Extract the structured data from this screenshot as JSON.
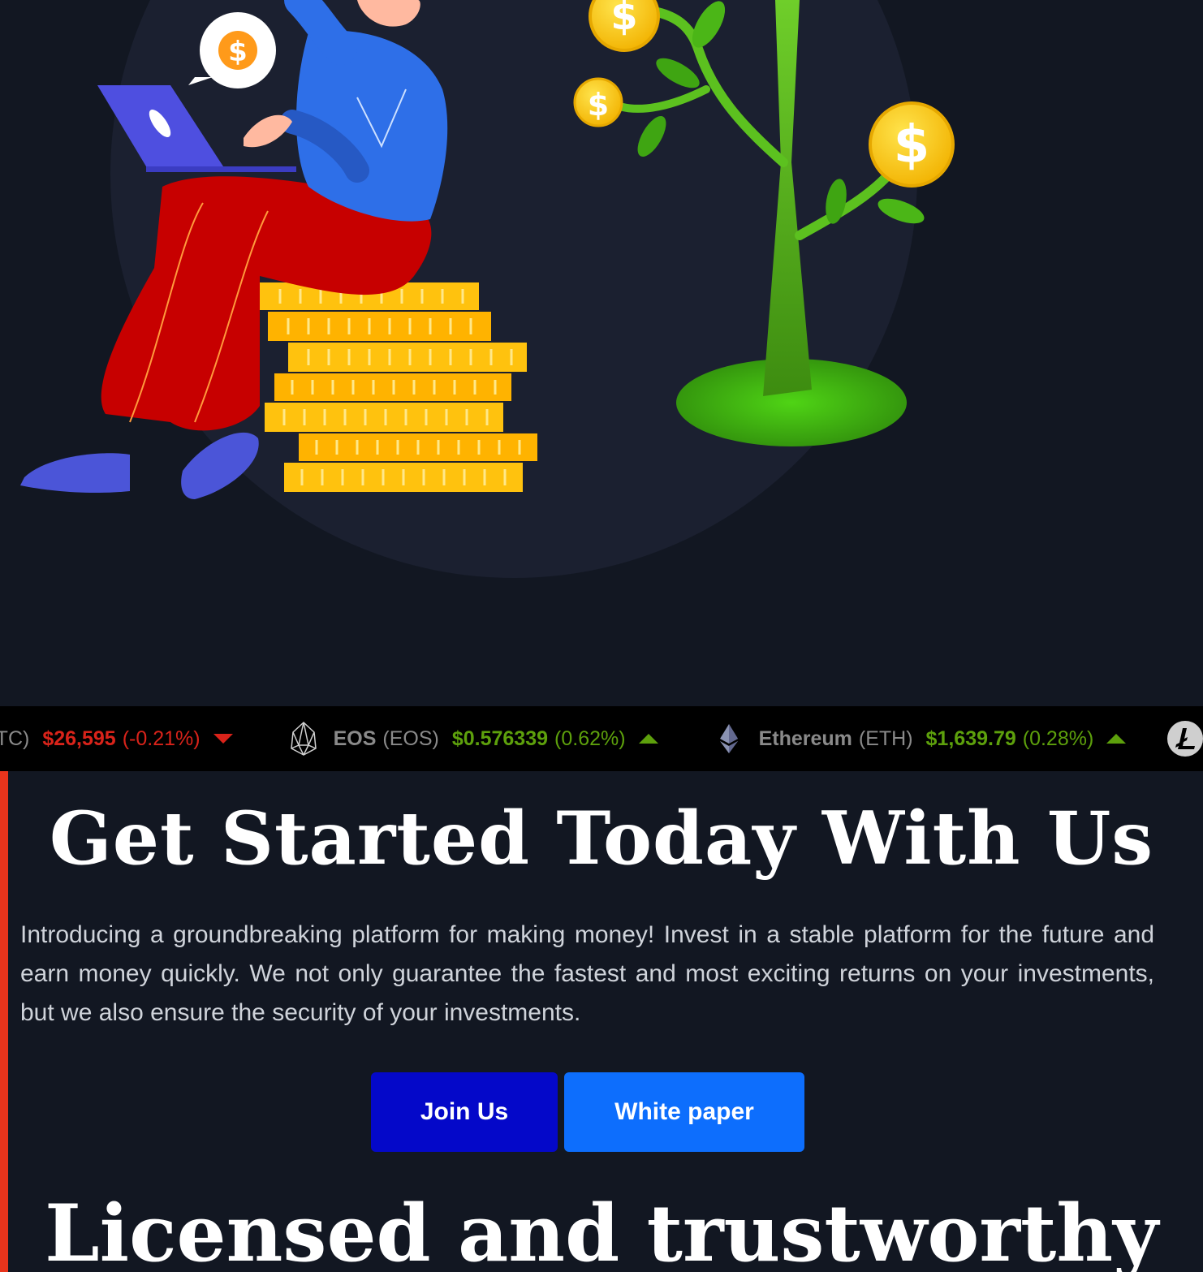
{
  "colors": {
    "background": "#121722",
    "ticker_bg": "#000000",
    "accent": "#e8341c",
    "price_down": "#d9231a",
    "price_up": "#5da00c",
    "join_button": "#0408c9",
    "whitepaper_button": "#0d6efd"
  },
  "hero": {
    "illustration": "person-with-laptop-on-coin-stack-and-money-tree",
    "icons": [
      "dollar-speech-bubble-icon",
      "laptop-icon",
      "coin-stack-icon",
      "money-tree-icon",
      "dollar-coin-icon"
    ]
  },
  "ticker": {
    "items": [
      {
        "name": "",
        "symbol": "BTC)",
        "price": "$26,595",
        "change": "(-0.21%)",
        "direction": "down",
        "icon": ""
      },
      {
        "name": "EOS",
        "symbol": "(EOS)",
        "price": "$0.576339",
        "change": "(0.62%)",
        "direction": "up",
        "icon": "eos-icon"
      },
      {
        "name": "Ethereum",
        "symbol": "(ETH)",
        "price": "$1,639.79",
        "change": "(0.28%)",
        "direction": "up",
        "icon": "ethereum-icon"
      }
    ],
    "trailing_icon": "litecoin-icon"
  },
  "main": {
    "heading": "Get Started Today With Us",
    "intro": "Introducing a groundbreaking platform for making money! Invest in a stable platform for the future and earn money quickly. We not only guarantee the fastest and most exciting returns on your investments, but we also ensure the security of your investments.",
    "join_label": "Join Us",
    "whitepaper_label": "White paper",
    "heading2": "Licensed and trustworthy"
  }
}
